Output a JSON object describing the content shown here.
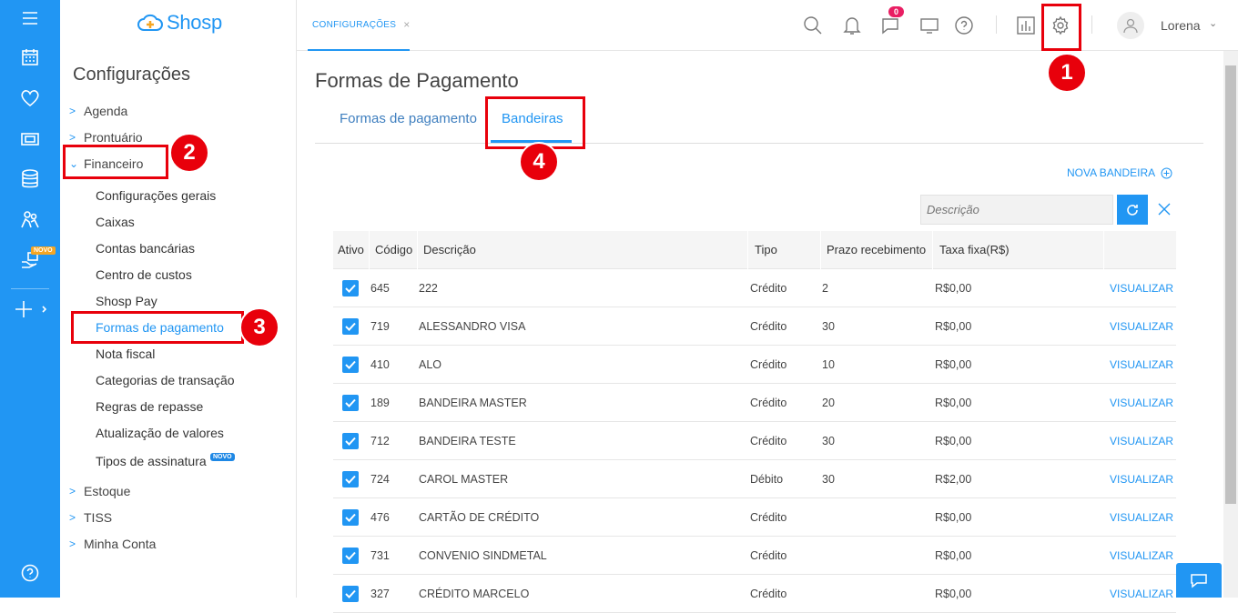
{
  "rail": {
    "icons": [
      "menu-icon",
      "calendar-icon",
      "heart-icon",
      "money-icon",
      "database-icon",
      "people-icon",
      "hand-icon",
      "plus-icon",
      "help-icon"
    ],
    "novo_badge": "NOVO"
  },
  "brand": {
    "name": "Shosp"
  },
  "sidebar": {
    "title": "Configurações",
    "sections": [
      {
        "label": "Agenda"
      },
      {
        "label": "Prontuário"
      },
      {
        "label": "Financeiro"
      },
      {
        "label": "Estoque"
      },
      {
        "label": "TISS"
      },
      {
        "label": "Minha Conta"
      }
    ],
    "financeiro_items": [
      "Configurações gerais",
      "Caixas",
      "Contas bancárias",
      "Centro de custos",
      "Shosp Pay",
      "Formas de pagamento",
      "Nota fiscal",
      "Categorias de transação",
      "Regras de repasse",
      "Atualização de valores",
      "Tipos de assinatura"
    ],
    "tipos_badge": "NOVO"
  },
  "topbar": {
    "tab_label": "CONFIGURAÇÕES",
    "tab_close": "×",
    "chat_count": "0",
    "user_name": "Lorena"
  },
  "annotations": {
    "n1": "1",
    "n2": "2",
    "n3": "3",
    "n4": "4"
  },
  "page": {
    "title": "Formas de Pagamento",
    "tabs": [
      "Formas de pagamento",
      "Bandeiras"
    ],
    "new_button": "NOVA BANDEIRA",
    "search_placeholder": "Descrição"
  },
  "table": {
    "columns": [
      "Ativo",
      "Código",
      "Descrição",
      "Tipo",
      "Prazo recebimento",
      "Taxa fixa(R$)"
    ],
    "action_label": "VISUALIZAR",
    "rows": [
      {
        "codigo": "645",
        "descricao": "222",
        "tipo": "Crédito",
        "prazo": "2",
        "taxa": "R$0,00"
      },
      {
        "codigo": "719",
        "descricao": "ALESSANDRO VISA",
        "tipo": "Crédito",
        "prazo": "30",
        "taxa": "R$0,00"
      },
      {
        "codigo": "410",
        "descricao": "ALO",
        "tipo": "Crédito",
        "prazo": "10",
        "taxa": "R$0,00"
      },
      {
        "codigo": "189",
        "descricao": "BANDEIRA MASTER",
        "tipo": "Crédito",
        "prazo": "20",
        "taxa": "R$0,00"
      },
      {
        "codigo": "712",
        "descricao": "BANDEIRA TESTE",
        "tipo": "Crédito",
        "prazo": "30",
        "taxa": "R$0,00"
      },
      {
        "codigo": "724",
        "descricao": "CAROL MASTER",
        "tipo": "Débito",
        "prazo": "30",
        "taxa": "R$2,00"
      },
      {
        "codigo": "476",
        "descricao": "CARTÃO DE CRÉDITO",
        "tipo": "Crédito",
        "prazo": "",
        "taxa": "R$0,00"
      },
      {
        "codigo": "731",
        "descricao": "CONVENIO SINDMETAL",
        "tipo": "Crédito",
        "prazo": "",
        "taxa": "R$0,00"
      },
      {
        "codigo": "327",
        "descricao": "CRÉDITO MARCELO",
        "tipo": "Crédito",
        "prazo": "",
        "taxa": "R$0,00"
      }
    ]
  }
}
